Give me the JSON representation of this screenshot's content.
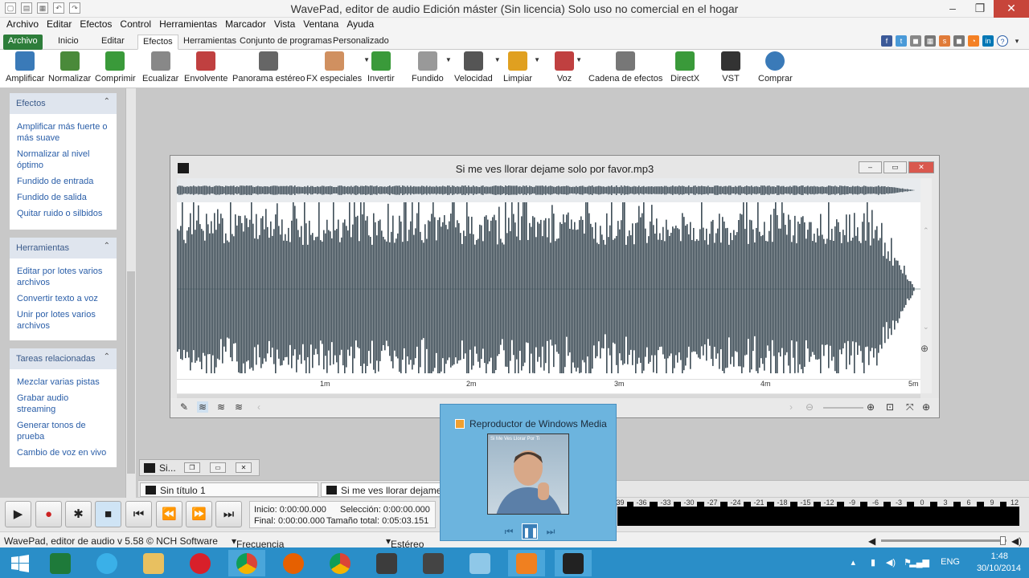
{
  "window": {
    "title": "WavePad, editor de audio Edición máster (Sin licencia) Solo uso no comercial en el hogar"
  },
  "menu": [
    "Archivo",
    "Editar",
    "Efectos",
    "Control",
    "Herramientas",
    "Marcador",
    "Vista",
    "Ventana",
    "Ayuda"
  ],
  "tabs": [
    "Archivo",
    "Inicio",
    "Editar",
    "Efectos",
    "Herramientas",
    "Conjunto de programas",
    "Personalizado"
  ],
  "active_tab": "Efectos",
  "ribbon": [
    {
      "label": "Amplificar",
      "icon": "amplify-icon",
      "color": "#3a7ab8"
    },
    {
      "label": "Normalizar",
      "icon": "normalize-icon",
      "color": "#4a8a3a"
    },
    {
      "label": "Comprimir",
      "icon": "compress-icon",
      "color": "#3a9a3a"
    },
    {
      "label": "Ecualizar",
      "icon": "equalizer-icon",
      "color": "#888888"
    },
    {
      "label": "Envolvente",
      "icon": "envelope-icon",
      "color": "#c04040"
    },
    {
      "label": "Panorama estéreo",
      "icon": "stereo-pan-icon",
      "color": "#666666"
    },
    {
      "label": "FX especiales",
      "icon": "special-fx-icon",
      "color": "#d09060"
    },
    {
      "label": "Invertir",
      "icon": "invert-icon",
      "color": "#3a9a3a"
    },
    {
      "label": "Fundido",
      "icon": "fade-icon",
      "color": "#999999"
    },
    {
      "label": "Velocidad",
      "icon": "speed-icon",
      "color": "#555555"
    },
    {
      "label": "Limpiar",
      "icon": "clean-icon",
      "color": "#e0a020"
    },
    {
      "label": "Voz",
      "icon": "voice-icon",
      "color": "#c04040"
    },
    {
      "label": "Cadena de efectos",
      "icon": "effect-chain-icon",
      "color": "#777777"
    },
    {
      "label": "DirectX",
      "icon": "directx-icon",
      "color": "#3a9a3a"
    },
    {
      "label": "VST",
      "icon": "vst-icon",
      "color": "#333333"
    },
    {
      "label": "Comprar",
      "icon": "buy-icon",
      "color": "#3a7ab8"
    }
  ],
  "sidebar": {
    "effects": {
      "title": "Efectos",
      "items": [
        "Amplificar más fuerte o más suave",
        "Normalizar al nivel óptimo",
        "Fundido de entrada",
        "Fundido de salida",
        "Quitar ruido o silbidos"
      ]
    },
    "tools": {
      "title": "Herramientas",
      "items": [
        "Editar por lotes varios archivos",
        "Convertir texto a voz",
        "Unir por lotes varios archivos"
      ]
    },
    "related": {
      "title": "Tareas relacionadas",
      "items": [
        "Mezclar varias pistas",
        "Grabar audio streaming",
        "Generar tonos de prueba",
        "Cambio de voz en vivo"
      ]
    }
  },
  "audio_window": {
    "title": "Si me ves llorar dejame solo por favor.mp3",
    "ruler": [
      "1m",
      "2m",
      "3m",
      "4m",
      "5m"
    ]
  },
  "minimized": {
    "title": "Si..."
  },
  "doc_tabs": [
    "Sin título 1",
    "Si me ves llorar dejame s"
  ],
  "info": {
    "inicio": "Inicio:  0:00:00.000",
    "seleccion": "Selección:  0:00:00.000",
    "final": "Final:  0:00:00.000",
    "total": "Tamaño total:  0:05:03.151"
  },
  "meter_labels": [
    "-39",
    "-36",
    "-33",
    "-30",
    "-27",
    "-24",
    "-21",
    "-18",
    "-15",
    "-12",
    "-9",
    "-6",
    "-3",
    "0",
    "3",
    "6",
    "9",
    "12"
  ],
  "status": {
    "app": "WavePad, editor de audio v 5.58 © NCH Software",
    "rate": "Frecuencia de muestreo: 44100",
    "channels": "Estéreo"
  },
  "wmp": {
    "title": "Reproductor de Windows Media",
    "album_text": "Si Me Ves Llorar Por Ti"
  },
  "tray": {
    "lang": "ENG",
    "time": "1:48",
    "date": "30/10/2014"
  },
  "colors": {
    "accent": "#2d7d3a",
    "link": "#2a5ea8",
    "waveform": "#3e4d57",
    "taskbar": "#2a8ec8"
  }
}
